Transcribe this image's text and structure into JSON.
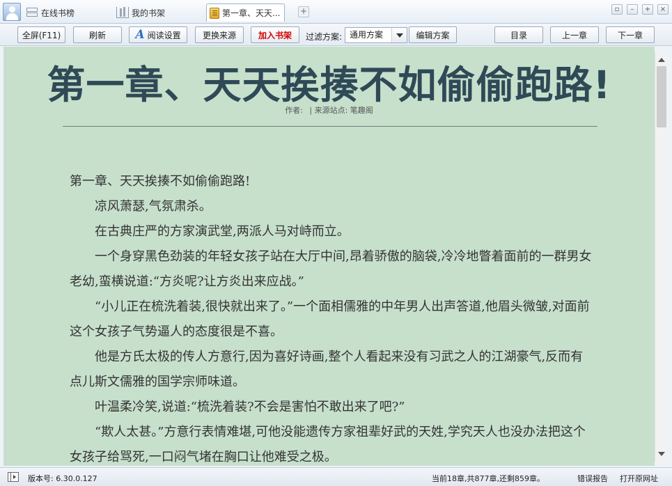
{
  "tabs": [
    {
      "label": "在线书榜",
      "icon": "list-icon"
    },
    {
      "label": "我的书架",
      "icon": "bookshelf-icon"
    },
    {
      "label": "第一章、天天...",
      "icon": "book-icon",
      "active": true
    }
  ],
  "new_tab_label": "+",
  "window_controls": [
    "restore-icon",
    "minimize-icon",
    "maximize-icon",
    "close-icon"
  ],
  "toolbar": {
    "fullscreen_label": "全屏(F11)",
    "refresh_label": "刷新",
    "reading_settings_label": "阅读设置",
    "change_source_label": "更换来源",
    "add_to_shelf_label": "加入书架",
    "filter_label": "过滤方案:",
    "filter_selected": "通用方案",
    "edit_scheme_label": "编辑方案",
    "toc_label": "目录",
    "prev_chapter_label": "上一章",
    "next_chapter_label": "下一章"
  },
  "reader": {
    "background_color": "#c7e0cc",
    "chapter_title": "第一章、天天挨揍不如偷偷跑路!",
    "author_label": "作者:",
    "source_label": "| 来源站点: 笔趣阁",
    "paragraphs": [
      "第一章、天天挨揍不如偷偷跑路!",
      "凉风萧瑟,气氛肃杀。",
      "在古典庄严的方家演武堂,两派人马对峙而立。",
      "一个身穿黑色劲装的年轻女孩子站在大厅中间,昂着骄傲的脑袋,冷冷地瞥着面前的一群男女老幼,蛮横说道:“方炎呢?让方炎出来应战。”",
      "“小儿正在梳洗着装,很快就出来了。”一个面相儒雅的中年男人出声答道,他眉头微皱,对面前这个女孩子气势逼人的态度很是不喜。",
      "他是方氏太极的传人方意行,因为喜好诗画,整个人看起来没有习武之人的江湖豪气,反而有点儿斯文儒雅的国学宗师味道。",
      "叶温柔冷笑,说道:“梳洗着装?不会是害怕不敢出来了吧?”",
      "“欺人太甚。”方意行表情难堪,可他没能遗传方家祖辈好武的天姓,学究天人也没办法把这个女孩子给骂死,一口闷气堵在胸口让他难受之极。"
    ]
  },
  "statusbar": {
    "version": "版本号: 6.30.0.127",
    "progress": "当前18章,共877章,还剩859章。",
    "report_error": "错误报告",
    "open_source_url": "打开原网址"
  }
}
